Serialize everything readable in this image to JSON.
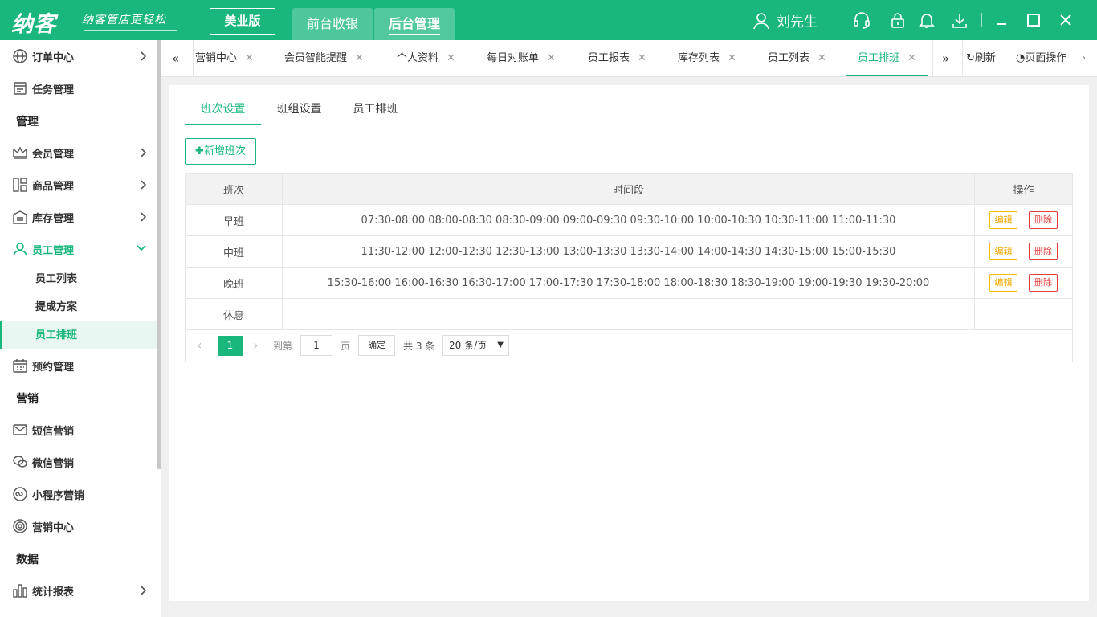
{
  "app": {
    "logo": "纳客",
    "slogan": "纳客管店更轻松",
    "edition": "美业版",
    "nav_front": "前台收银",
    "nav_back": "后台管理",
    "user_name": "刘先生"
  },
  "colors": {
    "brand": "#19b77c",
    "edit": "#f0a800",
    "delete": "#e23b3b"
  },
  "sidebar": {
    "order_center": "订单中心",
    "task_mgmt": "任务管理",
    "section_manage": "管理",
    "member_mgmt": "会员管理",
    "goods_mgmt": "商品管理",
    "stock_mgmt": "库存管理",
    "staff_mgmt": "员工管理",
    "staff_list": "员工列表",
    "commission": "提成方案",
    "staff_schedule": "员工排班",
    "booking_mgmt": "预约管理",
    "section_marketing": "营销",
    "sms_marketing": "短信营销",
    "wechat_marketing": "微信营销",
    "miniapp_marketing": "小程序营销",
    "marketing_center": "营销中心",
    "section_data": "数据",
    "stats_report": "统计报表"
  },
  "tabs": [
    {
      "label": "营销中心"
    },
    {
      "label": "会员智能提醒"
    },
    {
      "label": "个人资料"
    },
    {
      "label": "每日对账单"
    },
    {
      "label": "员工报表"
    },
    {
      "label": "库存列表"
    },
    {
      "label": "员工列表"
    },
    {
      "label": "员工排班"
    }
  ],
  "tab_actions": {
    "refresh": "刷新",
    "page_ops": "页面操作"
  },
  "subtabs": [
    "班次设置",
    "班组设置",
    "员工排班"
  ],
  "add_button": "新增班次",
  "table": {
    "headers": [
      "班次",
      "时间段",
      "操作"
    ],
    "rows": [
      {
        "name": "早班",
        "periods": "07:30-08:00 08:00-08:30 08:30-09:00 09:00-09:30 09:30-10:00 10:00-10:30 10:30-11:00 11:00-11:30"
      },
      {
        "name": "中班",
        "periods": "11:30-12:00 12:00-12:30 12:30-13:00 13:00-13:30 13:30-14:00 14:00-14:30 14:30-15:00 15:00-15:30"
      },
      {
        "name": "晚班",
        "periods": "15:30-16:00 16:00-16:30 16:30-17:00 17:00-17:30 17:30-18:00 18:00-18:30 18:30-19:00 19:00-19:30 19:30-20:00"
      },
      {
        "name": "休息",
        "periods": ""
      }
    ],
    "edit_label": "编辑",
    "delete_label": "删除"
  },
  "pager": {
    "current_page": "1",
    "goto_label": "到第",
    "goto_value": "1",
    "page_unit": "页",
    "confirm": "确定",
    "total": "共 3 条",
    "page_size": "20 条/页"
  }
}
